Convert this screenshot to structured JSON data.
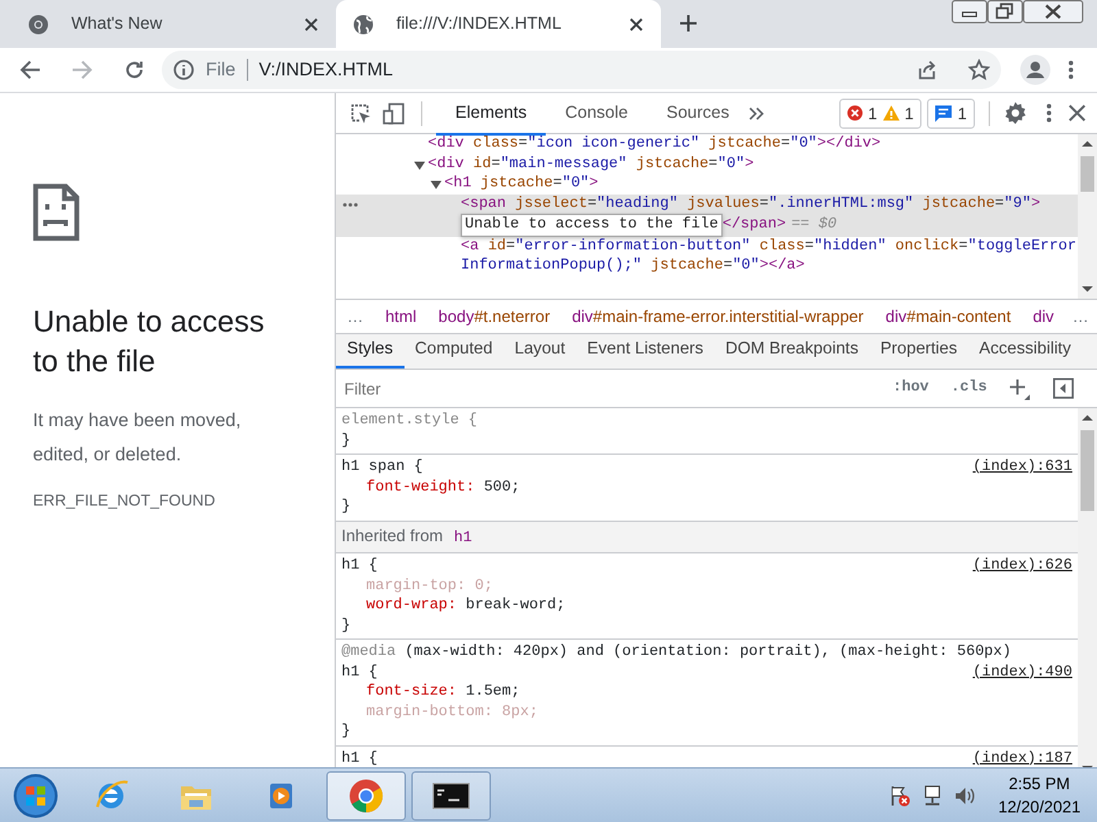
{
  "browser": {
    "tabs": [
      {
        "kind": "chrome",
        "title": "What's New",
        "selected": false
      },
      {
        "kind": "globe",
        "title": "file:///V:/INDEX.HTML",
        "selected": true
      }
    ],
    "nav": {
      "back_disabled": false,
      "forward_disabled": true
    },
    "address": {
      "scheme_label": "File",
      "url": "V:/INDEX.HTML"
    }
  },
  "page": {
    "title": "Unable to access to the file",
    "description": "It may have been moved, edited, or deleted.",
    "error_code": "ERR_FILE_NOT_FOUND"
  },
  "devtools": {
    "tabs": [
      {
        "label": "Elements",
        "selected": true
      },
      {
        "label": "Console",
        "selected": false
      },
      {
        "label": "Sources",
        "selected": false
      }
    ],
    "counts": {
      "errors": "1",
      "warnings": "1",
      "messages": "1"
    },
    "dom_tree": [
      {
        "markup": "<div class=\"icon icon-generic\" jstcache=\"0\"></div>",
        "selected": false
      },
      {
        "markup": "<div id=\"main-message\" jstcache=\"0\">",
        "selected": false,
        "expanded": true,
        "children": [
          {
            "markup": "<h1 jstcache=\"0\">",
            "selected": false,
            "expanded": true,
            "children": [
              {
                "markup": "<span jsselect=\"heading\" jsvalues=\".innerHTML:msg\" jstcache=\"9\">",
                "selected": true,
                "edit_text": "Unable to access to the file",
                "closing_tag": "</span>",
                "console_ref": "== $0"
              },
              {
                "markup": "<a id=\"error-information-button\" class=\"hidden\" onclick=\"toggleErrorInformationPopup();\" jstcache=\"0\"></a>",
                "selected": false
              }
            ]
          }
        ]
      }
    ],
    "breadcrumbs": {
      "lead": "…",
      "items": [
        "html",
        "body#t.neterror",
        "div#main-frame-error.interstitial-wrapper",
        "div#main-content",
        "div"
      ],
      "trail": "…"
    },
    "subtabs": [
      {
        "label": "Styles",
        "selected": true
      },
      {
        "label": "Computed",
        "selected": false
      },
      {
        "label": "Layout",
        "selected": false
      },
      {
        "label": "Event Listeners",
        "selected": false
      },
      {
        "label": "DOM Breakpoints",
        "selected": false
      },
      {
        "label": "Properties",
        "selected": false
      },
      {
        "label": "Accessibility",
        "selected": false
      }
    ],
    "styles_toolbar": {
      "placeholder": "Filter",
      "hov": ":hov",
      "cls": ".cls"
    },
    "rules": [
      {
        "kind": "element",
        "selector": "element.style {",
        "end": "}"
      },
      {
        "kind": "rule",
        "selector": "h1 span {",
        "source": "(index):631",
        "props": [
          {
            "name": "font-weight:",
            "value": "500;",
            "overridden": false
          }
        ],
        "end": "}"
      },
      {
        "kind": "inherited",
        "label": "Inherited from",
        "tag": "h1"
      },
      {
        "kind": "rule",
        "selector": "h1 {",
        "source": "(index):626",
        "props": [
          {
            "name": "margin-top:",
            "value": "0;",
            "overridden": true
          },
          {
            "name": "word-wrap:",
            "value": "break-word;",
            "overridden": false
          }
        ],
        "end": "}"
      },
      {
        "kind": "media",
        "media": "@media",
        "query": "(max-width: 420px) and (orientation: portrait), (max-height: 560px)",
        "selector": "h1 {",
        "source": "(index):490",
        "props": [
          {
            "name": "font-size:",
            "value": "1.5em;",
            "overridden": false
          },
          {
            "name": "margin-bottom:",
            "value": "8px;",
            "overridden": true
          }
        ],
        "end": "}"
      },
      {
        "kind": "rule",
        "selector": "h1 {",
        "source": "(index):187"
      }
    ]
  },
  "taskbar": {
    "apps": [
      {
        "kind": "ie",
        "running": false,
        "active": false
      },
      {
        "kind": "folder",
        "running": false,
        "active": false
      },
      {
        "kind": "media",
        "running": false,
        "active": false
      },
      {
        "kind": "chrome",
        "running": true,
        "active": true
      },
      {
        "kind": "cmd",
        "running": true,
        "active": false
      }
    ],
    "time": "2:55 PM",
    "date": "12/20/2021"
  }
}
